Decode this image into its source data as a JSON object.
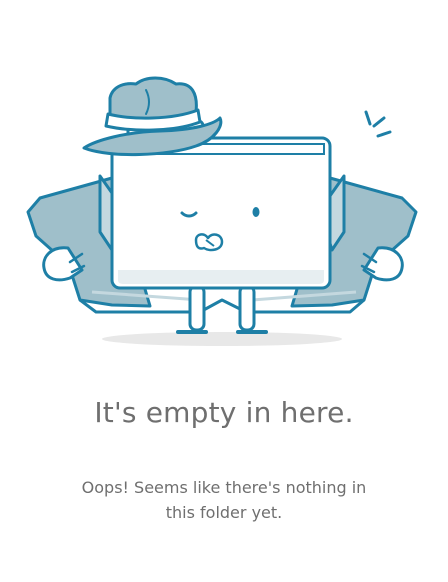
{
  "empty_state": {
    "title": "It's empty in here.",
    "message": "Oops! Seems like there's nothing in this folder yet.",
    "illustration_icon": "folder-character-icon"
  },
  "colors": {
    "outline": "#1e7fa6",
    "coat": "#9fbfca",
    "coat_light": "#c4d8df",
    "folder_body": "#ffffff",
    "folder_shadow": "#e7eef1",
    "ground_shadow": "#e8e8e8",
    "text": "#6f6f6f"
  }
}
